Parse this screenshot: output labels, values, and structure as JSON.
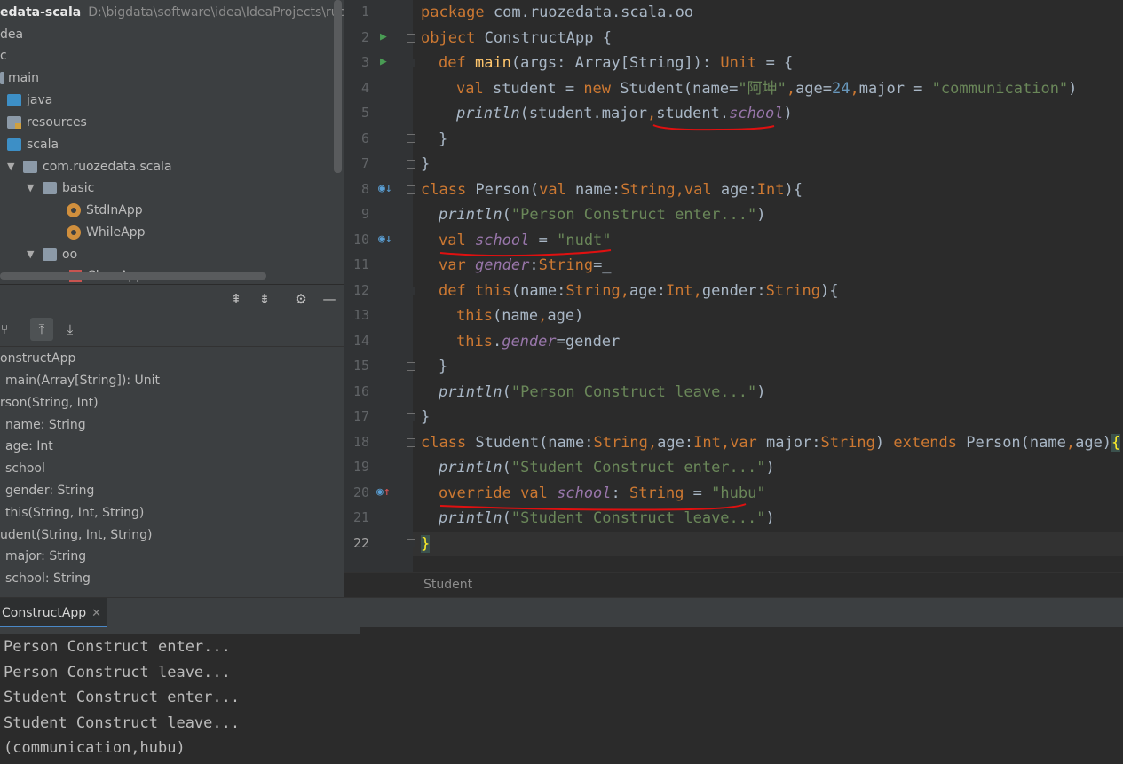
{
  "project": {
    "title": "edata-scala",
    "path": "D:\\bigdata\\software\\idea\\IdeaProjects\\ruozed",
    "items": [
      {
        "label": "dea"
      },
      {
        "label": "c"
      },
      {
        "label": "main"
      },
      {
        "label": "java"
      },
      {
        "label": "resources"
      },
      {
        "label": "scala"
      },
      {
        "label": "com.ruozedata.scala"
      },
      {
        "label": "basic"
      },
      {
        "label": "StdInApp"
      },
      {
        "label": "WhileApp"
      },
      {
        "label": "oo"
      },
      {
        "label": "ClassApp"
      }
    ]
  },
  "structure": {
    "toolbar_icons": [
      "expand-all-icon",
      "collapse-all-icon",
      "gear-icon",
      "minimize-icon"
    ],
    "items": [
      "onstructApp",
      "main(Array[String]): Unit",
      "rson(String, Int)",
      "name: String",
      "age: Int",
      "school",
      "gender: String",
      "this(String, Int, String)",
      "udent(String, Int, String)",
      "major: String",
      "school: String"
    ]
  },
  "editor": {
    "line_numbers": [
      "1",
      "2",
      "3",
      "4",
      "5",
      "6",
      "7",
      "8",
      "9",
      "10",
      "11",
      "12",
      "13",
      "14",
      "15",
      "16",
      "17",
      "18",
      "19",
      "20",
      "21",
      "22"
    ],
    "current_line": "22",
    "code": {
      "l1a": "package",
      "l1b": " com.ruozedata.scala.oo",
      "l2a": "object",
      "l2b": " ConstructApp {",
      "l3a": "def",
      "l3b": "main",
      "l3c": "(args: ",
      "l3d": "Array",
      "l3e": "[",
      "l3f": "String",
      "l3g": "]): ",
      "l3h": "Unit",
      "l3i": " = {",
      "l4a": "val",
      "l4b": " student = ",
      "l4c": "new",
      "l4d": " Student(name=",
      "l4e": "\"阿坤\"",
      "l4f": ",",
      "l4g": "age=",
      "l4h": "24",
      "l4i": ",",
      "l4j": "major = ",
      "l4k": "\"communication\"",
      "l4l": ")",
      "l5a": "println",
      "l5b": "(student.major",
      "l5c": ",",
      "l5d": "student.",
      "l5e": "school",
      "l5f": ")",
      "l6": "}",
      "l7": "}",
      "l8a": "class",
      "l8b": " Person(",
      "l8c": "val",
      "l8d": " name:",
      "l8e": "String",
      "l8f": ",",
      "l8g": "val",
      "l8h": " age:",
      "l8i": "Int",
      "l8j": "){",
      "l9a": "println",
      "l9b": "(",
      "l9c": "\"Person Construct enter...\"",
      "l9d": ")",
      "l10a": "val",
      "l10b": "school",
      "l10c": " = ",
      "l10d": "\"nudt\"",
      "l11a": "var",
      "l11b": "gender",
      "l11c": ":",
      "l11d": "String",
      "l11e": "=_",
      "l12a": "def",
      "l12b": " this",
      "l12c": "(name:",
      "l12d": "String",
      "l12e": ",",
      "l12f": "age:",
      "l12g": "Int",
      "l12h": ",",
      "l12i": "gender:",
      "l12j": "String",
      "l12k": "){",
      "l13a": "this",
      "l13b": "(name",
      "l13c": ",",
      "l13d": "age)",
      "l14a": "this",
      "l14b": ".",
      "l14c": "gender",
      "l14d": "=gender",
      "l15": "}",
      "l16a": "println",
      "l16b": "(",
      "l16c": "\"Person Construct leave...\"",
      "l16d": ")",
      "l17": "}",
      "l18a": "class",
      "l18b": " Student(name:",
      "l18c": "String",
      "l18d": ",",
      "l18e": "age:",
      "l18f": "Int",
      "l18g": ",",
      "l18h": "var",
      "l18i": " major:",
      "l18j": "String",
      "l18k": ") ",
      "l18l": "extends",
      "l18m": " Person(name",
      "l18n": ",",
      "l18o": "age)",
      "l18p": "{",
      "l19a": "println",
      "l19b": "(",
      "l19c": "\"Student Construct enter...\"",
      "l19d": ")",
      "l20a": "override",
      "l20b": "val",
      "l20c": "school",
      "l20d": ": ",
      "l20e": "String",
      "l20f": " = ",
      "l20g": "\"hubu\"",
      "l21a": "println",
      "l21b": "(",
      "l21c": "\"Student Construct leave...\"",
      "l21d": ")",
      "l22": "}"
    },
    "breadcrumb": "Student"
  },
  "run": {
    "tab_label": "ConstructApp",
    "output": [
      "Person Construct enter...",
      "Person Construct leave...",
      "Student Construct enter...",
      "Student Construct leave...",
      "(communication,hubu)"
    ]
  },
  "colors": {
    "keyword": "#cc7832",
    "string": "#6a8759",
    "number": "#6897bb",
    "field": "#9876aa",
    "function": "#ffc66d",
    "annotation": "#e01010"
  }
}
